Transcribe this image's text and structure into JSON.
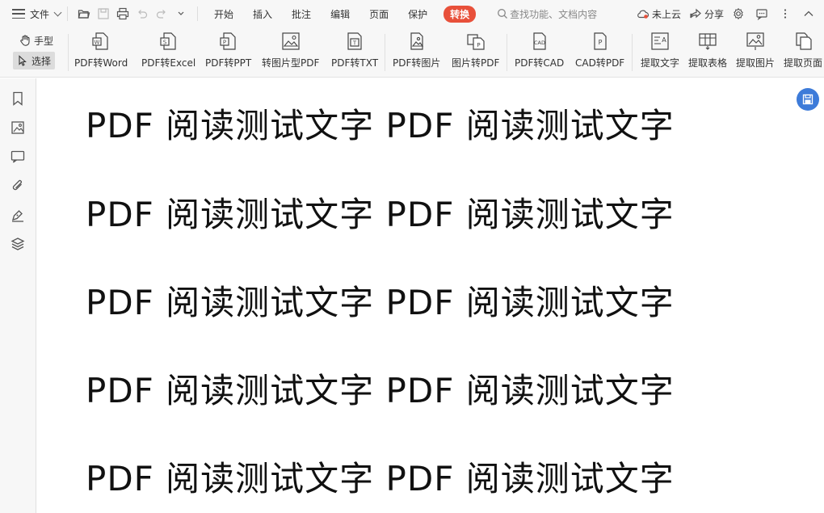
{
  "menu": {
    "file_label": "文件",
    "tabs": [
      {
        "label": "开始"
      },
      {
        "label": "插入"
      },
      {
        "label": "批注"
      },
      {
        "label": "编辑"
      },
      {
        "label": "页面"
      },
      {
        "label": "保护"
      },
      {
        "label": "转换",
        "active": true
      }
    ],
    "search_placeholder": "查找功能、文档内容",
    "right": {
      "cloud_label": "未上云",
      "share_label": "分享"
    }
  },
  "toolbar": {
    "hand_label": "手型",
    "select_label": "选择",
    "tools": [
      {
        "label": "PDF转Word",
        "icon": "pdf-to-word-icon"
      },
      {
        "label": "PDF转Excel",
        "icon": "pdf-to-excel-icon"
      },
      {
        "label": "PDF转PPT",
        "icon": "pdf-to-ppt-icon"
      },
      {
        "label": "转图片型PDF",
        "icon": "to-image-pdf-icon"
      },
      {
        "label": "PDF转TXT",
        "icon": "pdf-to-txt-icon"
      },
      {
        "label": "PDF转图片",
        "icon": "pdf-to-image-icon"
      },
      {
        "label": "图片转PDF",
        "icon": "image-to-pdf-icon"
      },
      {
        "label": "PDF转CAD",
        "icon": "pdf-to-cad-icon"
      },
      {
        "label": "CAD转PDF",
        "icon": "cad-to-pdf-icon"
      },
      {
        "label": "提取文字",
        "icon": "extract-text-icon"
      },
      {
        "label": "提取表格",
        "icon": "extract-table-icon"
      },
      {
        "label": "提取图片",
        "icon": "extract-image-icon"
      },
      {
        "label": "提取页面",
        "icon": "extract-page-icon"
      }
    ]
  },
  "document": {
    "lines": [
      "PDF 阅读测试文字 PDF 阅读测试文字",
      "PDF 阅读测试文字 PDF 阅读测试文字",
      "PDF 阅读测试文字 PDF 阅读测试文字",
      "PDF 阅读测试文字 PDF 阅读测试文字",
      "PDF 阅读测试文字 PDF 阅读测试文字"
    ]
  },
  "colors": {
    "accent": "#e8503a",
    "float_button": "#3d7bd9"
  }
}
